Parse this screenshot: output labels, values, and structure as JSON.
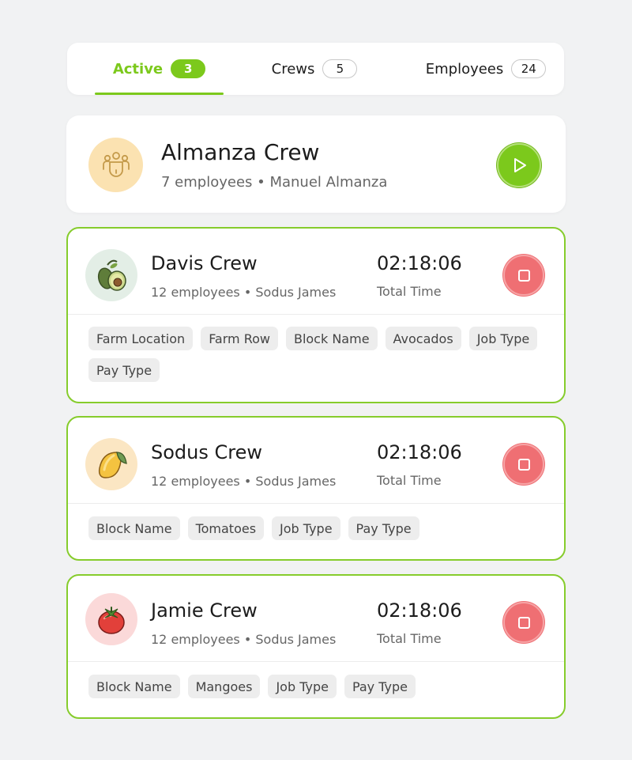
{
  "tabs": [
    {
      "label": "Active",
      "count": "3"
    },
    {
      "label": "Crews",
      "count": "5"
    },
    {
      "label": "Employees",
      "count": "24"
    }
  ],
  "featured": {
    "name": "Almanza Crew",
    "meta": "7 employees • Manuel Almanza",
    "icon": "crew-group-icon",
    "action_icon": "play-icon"
  },
  "active_crews": [
    {
      "name": "Davis Crew",
      "meta": "12 employees • Sodus James",
      "timer": "02:18:06",
      "timer_label": "Total Time",
      "icon": "avocado-icon",
      "tags": [
        "Farm Location",
        "Farm Row",
        "Block Name",
        "Avocados",
        "Job Type",
        "Pay Type"
      ]
    },
    {
      "name": "Sodus Crew",
      "meta": "12 employees • Sodus James",
      "timer": "02:18:06",
      "timer_label": "Total Time",
      "icon": "mango-icon",
      "tags": [
        "Block Name",
        "Tomatoes",
        "Job Type",
        "Pay Type"
      ]
    },
    {
      "name": "Jamie Crew",
      "meta": "12 employees • Sodus James",
      "timer": "02:18:06",
      "timer_label": "Total Time",
      "icon": "tomato-icon",
      "tags": [
        "Block Name",
        "Mangoes",
        "Job Type",
        "Pay Type"
      ]
    }
  ],
  "colors": {
    "accent": "#7cc91c",
    "stop": "#ef6f73",
    "background": "#f1f2f3"
  }
}
